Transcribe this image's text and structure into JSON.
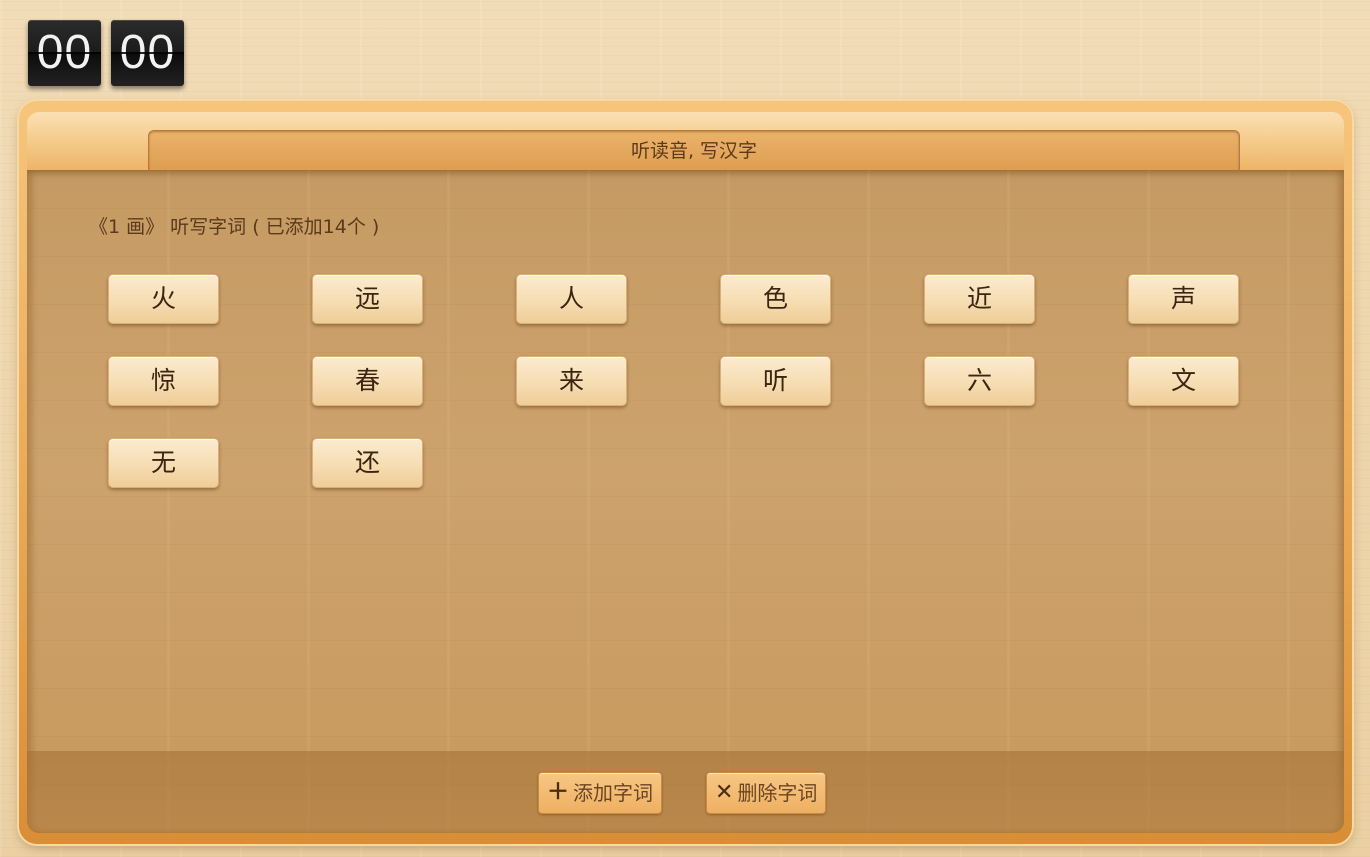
{
  "timer": {
    "minutes": "00",
    "seconds": "00"
  },
  "header": {
    "title": "听读音, 写汉字"
  },
  "section": {
    "label": "《1 画》 听写字词 ( 已添加14个 )"
  },
  "words": [
    "火",
    "远",
    "人",
    "色",
    "近",
    "声",
    "惊",
    "春",
    "来",
    "听",
    "六",
    "文",
    "无",
    "还"
  ],
  "footer": {
    "add_icon": "＋",
    "add_label": "添加字词",
    "delete_icon": "✕",
    "delete_label": "删除字词"
  },
  "icons": {
    "add": "plus-icon",
    "delete": "close-icon"
  },
  "colors": {
    "accent": "#eeb062",
    "text": "#5a3a1b",
    "clock_bg": "#1c1c1c"
  }
}
